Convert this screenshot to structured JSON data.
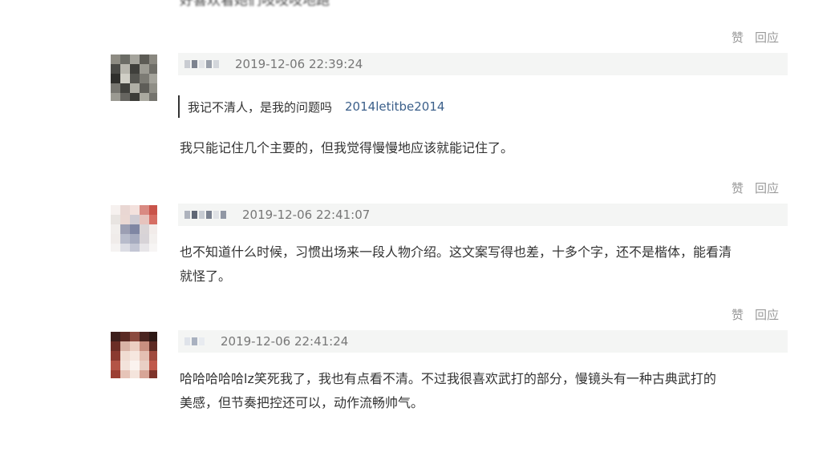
{
  "top_cutoff_text": "好喜欢看她们吱吱吱地跑",
  "comments": [
    {
      "date": "2019-12-06 22:39:24",
      "quote": {
        "text": "我记不清人，是我的问题吗",
        "author": "2014letitbe2014"
      },
      "text": "我只能记住几个主要的，但我觉得慢慢地应该就能记住了。",
      "like_label": "赞",
      "reply_label": "回应"
    },
    {
      "date": "2019-12-06 22:41:07",
      "text_line1": "也不知道什么时候，习惯出场来一段人物介绍。这文案写得也差，十多个字，还不是楷体，能看清",
      "text_line2": "就怪了。",
      "like_label": "赞",
      "reply_label": "回应"
    },
    {
      "date": "2019-12-06 22:41:24",
      "text_line1": "哈哈哈哈哈lz笑死我了，我也有点看不清。不过我很喜欢武打的部分，慢镜头有一种古典武打的",
      "text_line2": "美感，但节奏把控还可以，动作流畅帅气。",
      "like_label": "赞",
      "reply_label": "回应"
    }
  ],
  "top_actions": {
    "like_label": "赞",
    "reply_label": "回应"
  }
}
